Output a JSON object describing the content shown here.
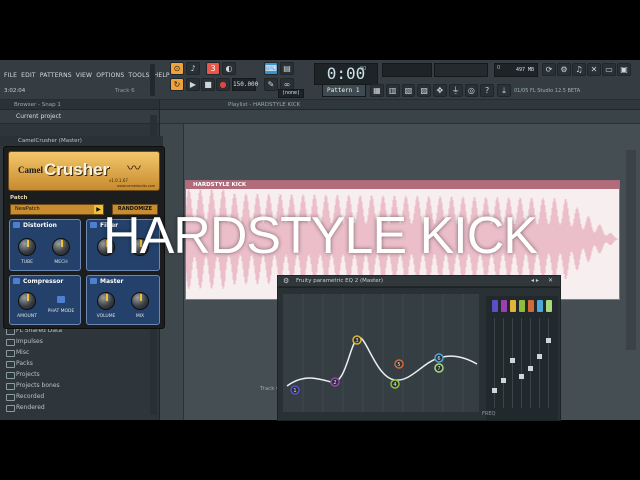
{
  "overlay_title": "HARDSTYLE KICK",
  "menu": [
    "FILE",
    "EDIT",
    "PATTERNS",
    "VIEW",
    "OPTIONS",
    "TOOLS",
    "HELP"
  ],
  "time_hint": "3:02:04",
  "track_hint": "Track 6",
  "transport": {
    "tempo": "150.000",
    "time": "0:00",
    "time_small": "00",
    "pattern": "Pattern 1",
    "snap": "(none)",
    "cpu": "497 MB",
    "cpu_small": "0",
    "version": "01/05  FL Studio 12.5 BETA"
  },
  "browser": {
    "title": "Browser - Snap 1",
    "current": "Current project",
    "items": [
      "FL Shared Data",
      "Impulses",
      "Misc",
      "Packs",
      "Projects",
      "Projects bones",
      "Recorded",
      "Rendered"
    ]
  },
  "playlist": {
    "title": "Playlist - HARDSTYLE KICK",
    "clip_label": "HARDSTYLE KICK",
    "track_label": "Track 6"
  },
  "plugin": {
    "title": "CamelCrusher (Master)",
    "brand_a": "Camel",
    "brand_b": "Crusher",
    "version": "v1.0.1.67",
    "site": "www.camelaudio.com",
    "patch_label": "Patch",
    "patch_value": "NewPatch",
    "randomize": "RANDOMIZE",
    "distortion": "Distortion",
    "filter": "Filter",
    "compressor": "Compressor",
    "master": "Master",
    "tube": "TUBE",
    "mech": "MECH",
    "amount": "AMOUNT",
    "phat": "PHAT MODE",
    "volume": "VOLUME",
    "mix": "MIX"
  },
  "eq": {
    "title": "Fruity parametric EQ 2 (Master)",
    "freq_label": "FREQ",
    "bands": [
      1,
      2,
      3,
      4,
      5,
      6,
      7
    ],
    "band_colors": [
      "#5b4ec9",
      "#9b3fb5",
      "#e0b437",
      "#8dbd3a",
      "#d26a3a",
      "#4fa7d8",
      "#a8d97c"
    ]
  },
  "colors": {
    "accent": "#f0a23a",
    "waveform": "#e9b9c6",
    "clip_header": "#b26b7a"
  }
}
